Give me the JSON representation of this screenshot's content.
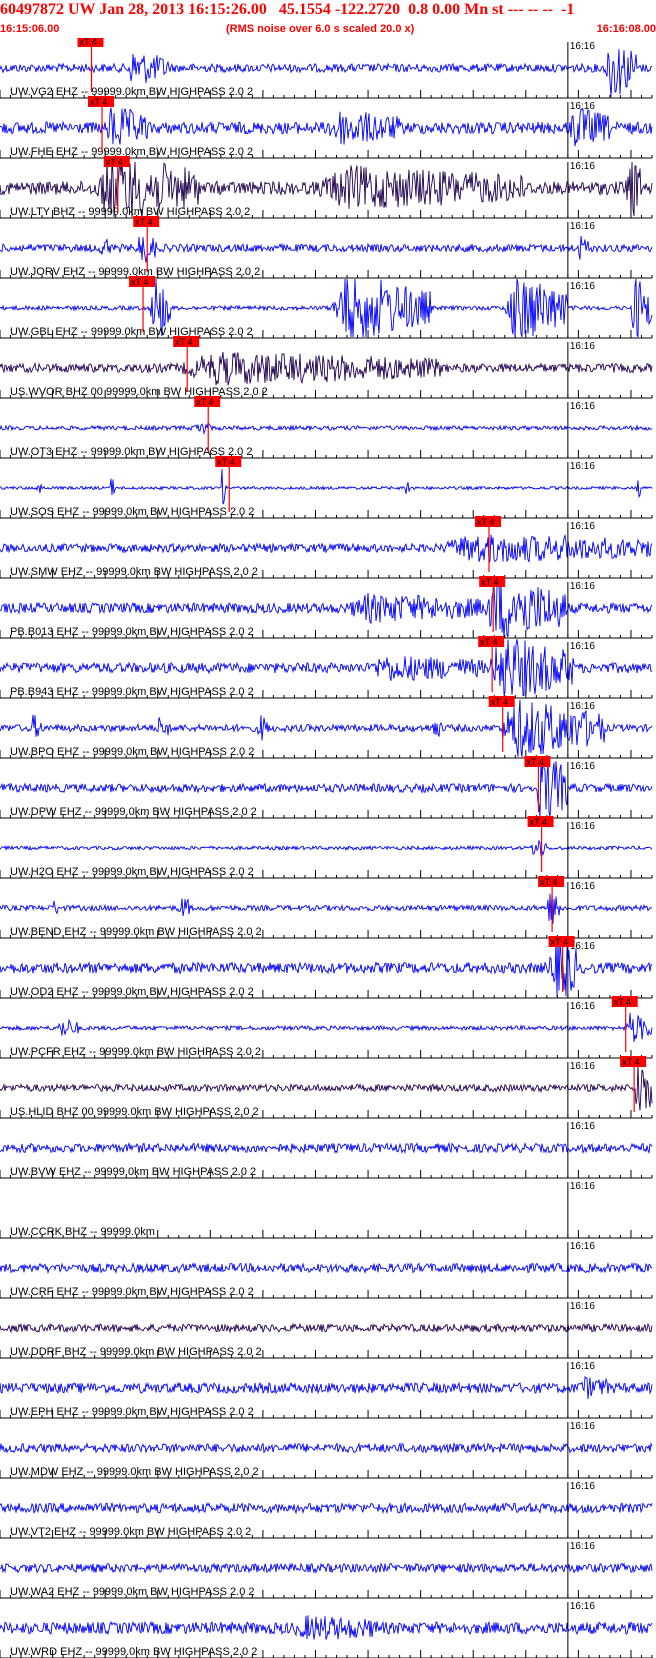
{
  "header": {
    "title": "60497872 UW Jan 28, 2013 16:15:26.00   45.1554 -122.2720  0.8 0.00 Mn st --- -- --  -1",
    "start_time": "16:15:06.00",
    "rms_note": "(RMS noise over 6.0 s scaled 20.0 x)",
    "end_time": "16:16:08.00"
  },
  "colors": {
    "trace_blue": "#0000ff",
    "trace_dark": "#200050",
    "pick": "#ff0000",
    "axis": "#000000",
    "text_red": "#ff0000"
  },
  "chart_data": {
    "type": "line",
    "x_range_seconds": [
      0,
      62
    ],
    "minute_label_second": 54,
    "pick_label": "xT 4",
    "tick_minor_step_s": 1,
    "tick_major_step_s": 5,
    "traces": [
      {
        "label": "UW.VG2 EHZ -- 99999.0km BW  HIGHPASS  2.0  2",
        "minute_label": "16:16",
        "pick_s": 8.7,
        "color": "blue",
        "noise": 0.14,
        "bursts": [
          {
            "t": 12,
            "d": 4,
            "a": 0.5
          },
          {
            "t": 57.5,
            "d": 3,
            "a": 1.0
          }
        ]
      },
      {
        "label": "UW.FHE EHZ -- 99999.0km BW  HIGHPASS  2.0  2",
        "minute_label": "16:16",
        "pick_s": 9.7,
        "color": "blue",
        "noise": 0.2,
        "bursts": [
          {
            "t": 10,
            "d": 4,
            "a": 0.6
          },
          {
            "t": 31,
            "d": 7,
            "a": 0.45
          },
          {
            "t": 54,
            "d": 4,
            "a": 0.55
          }
        ]
      },
      {
        "label": "UW.LTY BHZ -- 99999.0km BW  HIGHPASS  2.0  2",
        "minute_label": "16:16",
        "pick_s": 11.2,
        "color": "dark",
        "noise": 0.22,
        "bursts": [
          {
            "t": 9,
            "d": 10,
            "a": 0.95
          },
          {
            "t": 30,
            "d": 20,
            "a": 0.55
          },
          {
            "t": 59.5,
            "d": 1.5,
            "a": 1.0
          }
        ]
      },
      {
        "label": "UW.JORV EHZ -- 99999.0km BW  HIGHPASS  2.0  2",
        "minute_label": "16:16",
        "pick_s": 14.0,
        "color": "blue",
        "noise": 0.13,
        "bursts": [
          {
            "t": 13,
            "d": 2,
            "a": 0.45
          },
          {
            "t": 9.5,
            "d": 1,
            "a": 0.4
          },
          {
            "t": 55,
            "d": 1,
            "a": 0.35
          }
        ]
      },
      {
        "label": "UW.GBL EHZ -- 99999.0km BW  HIGHPASS  2.0  2",
        "minute_label": "16:16",
        "pick_s": 13.6,
        "color": "blue",
        "noise": 0.07,
        "bursts": [
          {
            "t": 14.3,
            "d": 2,
            "a": 1.2
          },
          {
            "t": 31.5,
            "d": 9.5,
            "a": 1.2
          },
          {
            "t": 48,
            "d": 6,
            "a": 1.2
          },
          {
            "t": 60,
            "d": 2,
            "a": 1.2
          }
        ]
      },
      {
        "label": "US.WVOR BHZ 00 99999.0km BW  HIGHPASS  2.0  2",
        "minute_label": "16:16",
        "pick_s": 17.8,
        "color": "dark",
        "noise": 0.15,
        "bursts": [
          {
            "t": 17,
            "d": 25,
            "a": 0.45
          }
        ]
      },
      {
        "label": "UW.OT3 EHZ -- 99999.0km BW  HIGHPASS  2.0  2",
        "minute_label": "16:16",
        "pick_s": 19.8,
        "color": "blue",
        "noise": 0.07,
        "bursts": [
          {
            "t": 18.5,
            "d": 1.5,
            "a": 0.25
          }
        ]
      },
      {
        "label": "UW.SOS EHZ -- 99999.0km BW  HIGHPASS  2.0  2",
        "minute_label": "16:16",
        "pick_s": 21.8,
        "color": "blue",
        "noise": 0.05,
        "bursts": [
          {
            "t": 3.5,
            "d": 0.4,
            "a": 0.45
          },
          {
            "t": 10.5,
            "d": 0.4,
            "a": 0.4
          },
          {
            "t": 21,
            "d": 0.6,
            "a": 0.6
          },
          {
            "t": 38.5,
            "d": 0.5,
            "a": 0.45
          },
          {
            "t": 60.5,
            "d": 0.4,
            "a": 0.5
          }
        ]
      },
      {
        "label": "UW.SMW EHZ -- 99999.0km BW  HIGHPASS  2.0  2",
        "minute_label": "16:16",
        "pick_s": 46.5,
        "color": "blue",
        "noise": 0.14,
        "bursts": [
          {
            "t": 42,
            "d": 20,
            "a": 0.4
          }
        ]
      },
      {
        "label": "PB.B013 EHZ -- 99999.0km BW  HIGHPASS  2.0  2",
        "minute_label": "16:16",
        "pick_s": 46.9,
        "color": "blue",
        "noise": 0.17,
        "bursts": [
          {
            "t": 46,
            "d": 8,
            "a": 1.0
          },
          {
            "t": 33,
            "d": 13,
            "a": 0.35
          }
        ]
      },
      {
        "label": "PB.B943 EHZ -- 99999.0km BW  HIGHPASS  2.0  2",
        "minute_label": "16:16",
        "pick_s": 46.8,
        "color": "blue",
        "noise": 0.17,
        "bursts": [
          {
            "t": 46.5,
            "d": 8,
            "a": 1.0
          },
          {
            "t": 35,
            "d": 11,
            "a": 0.3
          }
        ]
      },
      {
        "label": "UW.BPO EHZ -- 99999.0km BW  HIGHPASS  2.0  2",
        "minute_label": "16:16",
        "pick_s": 47.8,
        "color": "blue",
        "noise": 0.12,
        "bursts": [
          {
            "t": 47.5,
            "d": 10,
            "a": 0.95
          },
          {
            "t": 3,
            "d": 1,
            "a": 0.35
          },
          {
            "t": 15,
            "d": 1,
            "a": 0.35
          },
          {
            "t": 24.5,
            "d": 1,
            "a": 0.4
          },
          {
            "t": 41,
            "d": 1,
            "a": 0.3
          }
        ]
      },
      {
        "label": "UW.DPW EHZ -- 99999.0km BW  HIGHPASS  2.0  2",
        "minute_label": "16:16",
        "pick_s": 51.2,
        "color": "blue",
        "noise": 0.14,
        "bursts": [
          {
            "t": 51,
            "d": 3,
            "a": 1.2
          }
        ]
      },
      {
        "label": "UW.H2O EHZ -- 99999.0km BW  HIGHPASS  2.0  2",
        "minute_label": "16:16",
        "pick_s": 51.5,
        "color": "blue",
        "noise": 0.06,
        "bursts": [
          {
            "t": 50.5,
            "d": 1.5,
            "a": 0.35
          }
        ]
      },
      {
        "label": "UW.BEND EHZ -- 99999.0km BW  HIGHPASS  2.0  2",
        "minute_label": "16:16",
        "pick_s": 52.5,
        "color": "blue",
        "noise": 0.09,
        "bursts": [
          {
            "t": 52,
            "d": 1.5,
            "a": 0.6
          },
          {
            "t": 17,
            "d": 1,
            "a": 0.4
          },
          {
            "t": 5,
            "d": 0.5,
            "a": 0.25
          }
        ]
      },
      {
        "label": "UW.OD2 EHZ -- 99999.0km BW  HIGHPASS  2.0  2",
        "minute_label": "16:16",
        "pick_s": 53.5,
        "color": "blue",
        "noise": 0.18,
        "bursts": [
          {
            "t": 52.2,
            "d": 2.6,
            "a": 1.2
          }
        ]
      },
      {
        "label": "UW.PCFR EHZ -- 99999.0km BW  HIGHPASS  2.0  2",
        "minute_label": "16:16",
        "pick_s": 59.5,
        "color": "blue",
        "noise": 0.07,
        "bursts": [
          {
            "t": 59.5,
            "d": 2.5,
            "a": 0.5
          },
          {
            "t": 5.5,
            "d": 2,
            "a": 0.3
          }
        ]
      },
      {
        "label": "US.HLID BHZ 00 99999.0km BW  HIGHPASS  2.0  2",
        "minute_label": "16:16",
        "pick_s": 60.3,
        "color": "dark",
        "noise": 0.12,
        "bursts": [
          {
            "t": 60.3,
            "d": 1.7,
            "a": 1.1
          }
        ]
      },
      {
        "label": "UW.BVW EHZ -- 99999.0km BW  HIGHPASS  2.0  2",
        "minute_label": "16:16",
        "pick_s": null,
        "color": "blue",
        "noise": 0.15,
        "bursts": []
      },
      {
        "label": "UW.CCRK BHZ -- 99999.0km",
        "minute_label": "16:16",
        "pick_s": null,
        "color": "none",
        "noise": 0,
        "bursts": []
      },
      {
        "label": "UW.CRF EHZ -- 99999.0km BW  HIGHPASS  2.0  2",
        "minute_label": "16:16",
        "pick_s": null,
        "color": "blue",
        "noise": 0.15,
        "bursts": []
      },
      {
        "label": "UW.DDRF BHZ -- 99999.0km BW  HIGHPASS  2.0  2",
        "minute_label": "16:16",
        "pick_s": null,
        "color": "dark",
        "noise": 0.13,
        "bursts": []
      },
      {
        "label": "UW.EPH EHZ -- 99999.0km BW  HIGHPASS  2.0  2",
        "minute_label": "16:16",
        "pick_s": null,
        "color": "blue",
        "noise": 0.17,
        "bursts": [
          {
            "t": 55,
            "d": 3,
            "a": 0.25
          }
        ]
      },
      {
        "label": "UW.MDW EHZ -- 99999.0km BW  HIGHPASS  2.0  2",
        "minute_label": "16:16",
        "pick_s": null,
        "color": "blue",
        "noise": 0.15,
        "bursts": []
      },
      {
        "label": "UW.VT2 EHZ -- 99999.0km BW  HIGHPASS  2.0  2",
        "minute_label": "16:16",
        "pick_s": null,
        "color": "blue",
        "noise": 0.16,
        "bursts": []
      },
      {
        "label": "UW.WA2 EHZ -- 99999.0km BW  HIGHPASS  2.0  2",
        "minute_label": "16:16",
        "pick_s": null,
        "color": "blue",
        "noise": 0.15,
        "bursts": []
      },
      {
        "label": "UW.WRD EHZ -- 99999.0km BW  HIGHPASS  2.0  2",
        "minute_label": "16:16",
        "pick_s": null,
        "color": "blue",
        "noise": 0.2,
        "bursts": [
          {
            "t": 28,
            "d": 8,
            "a": 0.25
          }
        ]
      }
    ]
  }
}
